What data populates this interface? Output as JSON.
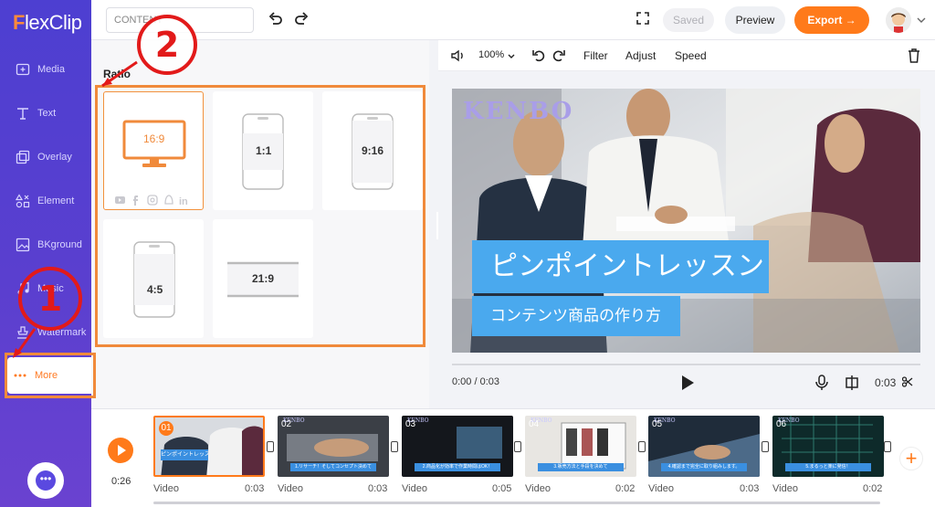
{
  "app": {
    "logo": "FlexClip"
  },
  "sidebar": {
    "items": [
      {
        "label": "Media",
        "icon": "media-icon"
      },
      {
        "label": "Text",
        "icon": "text-icon"
      },
      {
        "label": "Overlay",
        "icon": "overlay-icon"
      },
      {
        "label": "Element",
        "icon": "element-icon"
      },
      {
        "label": "BKground",
        "icon": "background-icon"
      },
      {
        "label": "Music",
        "icon": "music-icon"
      },
      {
        "label": "Watermark",
        "icon": "watermark-icon"
      },
      {
        "label": "More",
        "icon": "more-icon",
        "active": true
      }
    ]
  },
  "topbar": {
    "project_name": "CONTENT",
    "saved_label": "Saved",
    "preview_label": "Preview",
    "export_label": "Export →"
  },
  "panel": {
    "title": "Ratio",
    "ratios": [
      "16:9",
      "1:1",
      "9:16",
      "4:5",
      "21:9"
    ],
    "selected": "16:9"
  },
  "editbar": {
    "zoom": "100%",
    "filter_label": "Filter",
    "adjust_label": "Adjust",
    "speed_label": "Speed"
  },
  "video": {
    "watermark": "KENBO",
    "title_text": "ピンポイントレッスン",
    "subtitle_text": "コンテンツ商品の作り方",
    "current_time": "0:00 / 0:03",
    "duration": "0:03"
  },
  "timeline": {
    "total_time": "0:26",
    "clips": [
      {
        "num": "01",
        "label": "Video",
        "dur": "0:03",
        "caption": "ピンポイントレッスン"
      },
      {
        "num": "02",
        "label": "Video",
        "dur": "0:03",
        "caption": "1.リサーチ！そしてコンセプト決めて"
      },
      {
        "num": "03",
        "label": "Video",
        "dur": "0:05",
        "caption": "2.商品化が効率で作業時間はOK！"
      },
      {
        "num": "04",
        "label": "Video",
        "dur": "0:02",
        "caption": "3.販売方法と手段を決めて"
      },
      {
        "num": "05",
        "label": "Video",
        "dur": "0:03",
        "caption": "4.確認まで完全に取り組みします。"
      },
      {
        "num": "06",
        "label": "Video",
        "dur": "0:02",
        "caption": "5.まるっと楽に発信！"
      }
    ]
  },
  "annotations": {
    "step1": "1",
    "step2": "2"
  },
  "colors": {
    "accent": "#ff7a1a",
    "sidebar": "#5a3fcf",
    "highlight": "#f08a3b",
    "annotation": "#e21a1a"
  }
}
